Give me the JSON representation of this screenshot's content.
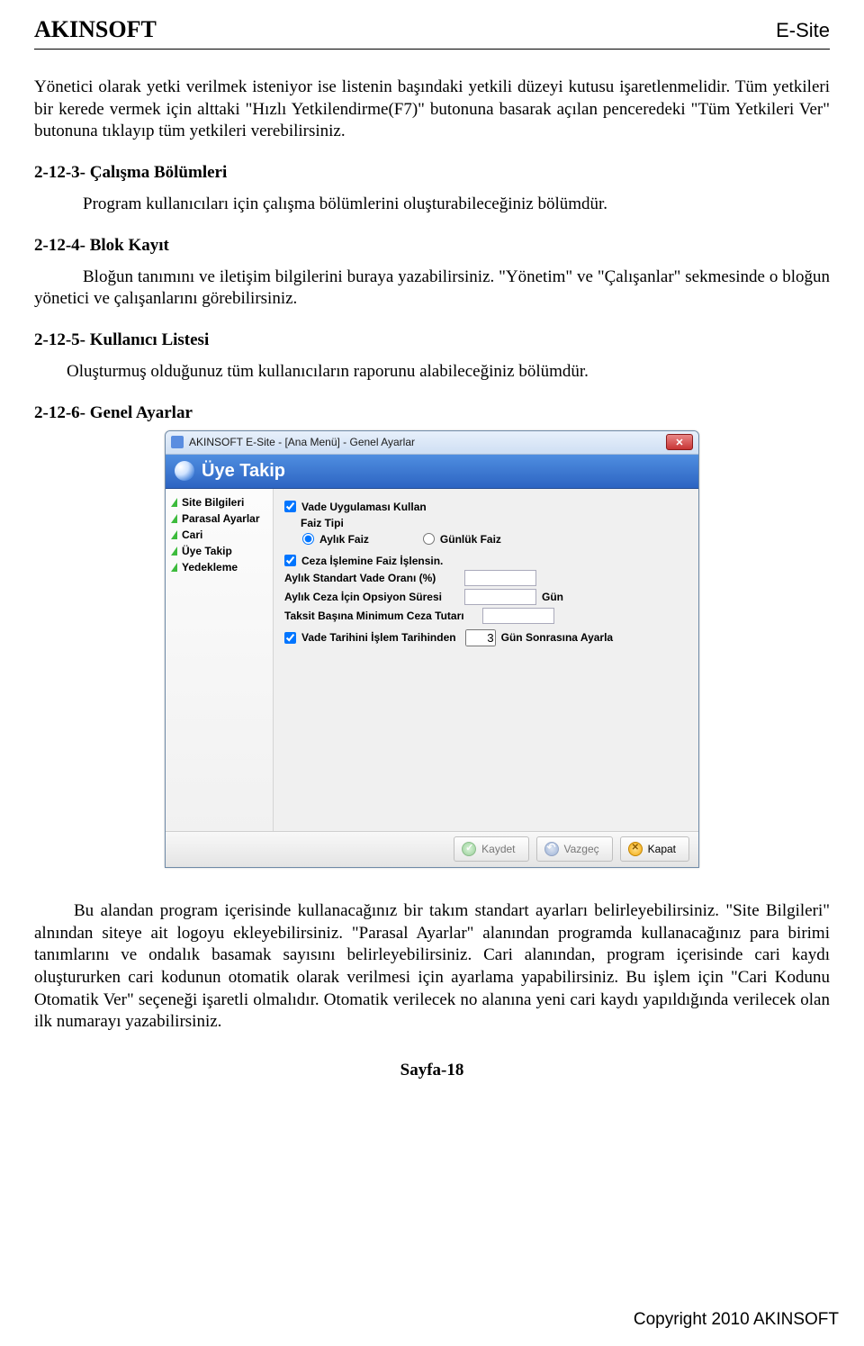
{
  "header": {
    "left": "AKINSOFT",
    "right": "E-Site"
  },
  "intro": "Yönetici olarak yetki verilmek isteniyor ise listenin başındaki yetkili düzeyi kutusu işaretlenmelidir. Tüm yetkileri bir kerede vermek için alttaki \"Hızlı Yetkilendirme(F7)\" butonuna basarak açılan penceredeki \"Tüm Yetkileri Ver\" butonuna tıklayıp tüm yetkileri verebilirsiniz.",
  "sections": [
    {
      "title": "2-12-3- Çalışma Bölümleri",
      "body": "Program kullanıcıları için çalışma bölümlerini oluşturabileceğiniz bölümdür."
    },
    {
      "title": "2-12-4- Blok Kayıt",
      "body": "Bloğun tanımını ve iletişim bilgilerini buraya yazabilirsiniz. \"Yönetim\" ve \"Çalışanlar\" sekmesinde o bloğun yönetici ve çalışanlarını görebilirsiniz."
    },
    {
      "title": "2-12-5- Kullanıcı Listesi",
      "body": "Oluşturmuş olduğunuz tüm kullanıcıların raporunu alabileceğiniz bölümdür."
    },
    {
      "title": "2-12-6- Genel Ayarlar",
      "body": ""
    }
  ],
  "window": {
    "title": "AKINSOFT E-Site        - [Ana Menü] - Genel Ayarlar",
    "banner": "Üye Takip",
    "sidebar": [
      "Site Bilgileri",
      "Parasal Ayarlar",
      "Cari",
      "Üye Takip",
      "Yedekleme"
    ],
    "cb_vade": "Vade Uygulaması Kullan",
    "faiz_tipi_label": "Faiz Tipi",
    "radio_aylik": "Aylık Faiz",
    "radio_gunluk": "Günlük Faiz",
    "cb_ceza": "Ceza İşlemine Faiz İşlensin.",
    "lbl_oran": "Aylık Standart Vade Oranı (%)",
    "lbl_opsiyon": "Aylık Ceza İçin Opsiyon Süresi",
    "lbl_gun": "Gün",
    "lbl_taksit": "Taksit Başına Minimum Ceza Tutarı",
    "cb_tarih": "Vade Tarihini İşlem Tarihinden",
    "val_sonra": "3",
    "lbl_sonra": "Gün Sonrasına Ayarla",
    "btn_kaydet": "Kaydet",
    "btn_vazgec": "Vazgeç",
    "btn_kapat": "Kapat"
  },
  "after_window": "Bu alandan program içerisinde kullanacağınız bir takım standart ayarları belirleyebilirsiniz. \"Site Bilgileri\" alnından siteye ait logoyu ekleyebilirsiniz. \"Parasal Ayarlar\" alanından programda kullanacağınız para birimi tanımlarını ve ondalık basamak sayısını belirleyebilirsiniz. Cari alanından, program içerisinde cari kaydı oluştururken cari kodunun otomatik olarak verilmesi için ayarlama yapabilirsiniz. Bu işlem için \"Cari Kodunu Otomatik Ver\" seçeneği işaretli olmalıdır. Otomatik verilecek no alanına yeni cari kaydı yapıldığında verilecek olan ilk numarayı yazabilirsiniz.",
  "page_number": "Sayfa-18",
  "copyright": "Copyright 2010 AKINSOFT"
}
